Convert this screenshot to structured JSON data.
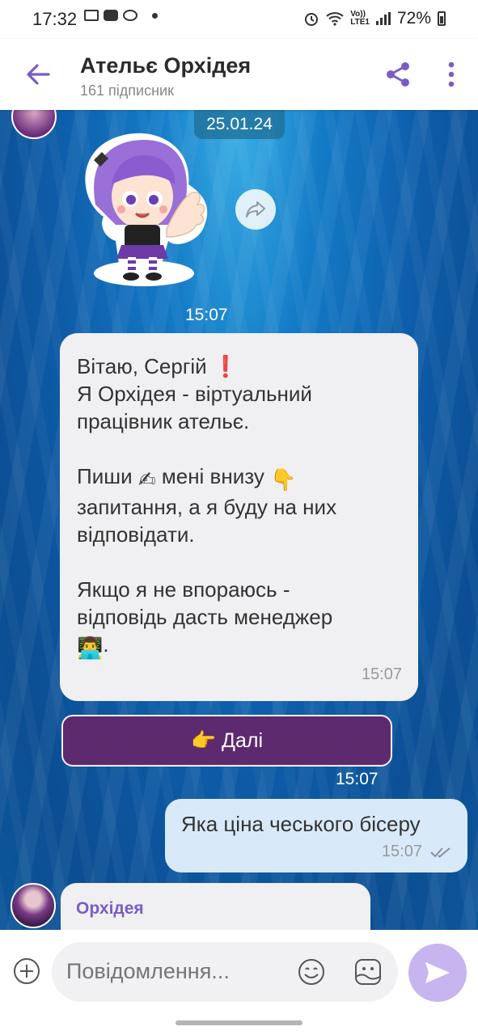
{
  "status_bar": {
    "time": "17:32",
    "network_small_top": "Vo))",
    "network_small_bottom": "LTE1",
    "battery": "72%"
  },
  "header": {
    "title": "Ательє Орхідея",
    "subtitle": "161 підписник",
    "accent_color": "#7b5cc6"
  },
  "chat": {
    "date": "25.01.24",
    "sticker_time": "15:07",
    "message": {
      "line1": "Вітаю, Сергій ❗",
      "line2": "Я Орхідея - віртуальний",
      "line3": "працівник ательє.",
      "line4a": "Пиши",
      "line4b": "мені внизу",
      "line5": "запитання, а я буду на них",
      "line6": "відповідати.",
      "line7": "Якщо я не впораюсь -",
      "line8": "відповідь дасть менеджер",
      "line9": ".",
      "time": "15:07",
      "emoji_write": "✍",
      "emoji_point_down": "👇",
      "emoji_manager": "👨‍💻"
    },
    "next_button": {
      "emoji": "👉",
      "label": "Далі",
      "time": "15:07",
      "color": "#5e2a6f"
    },
    "outgoing": {
      "text": "Яка ціна чеського бісеру",
      "time": "15:07"
    },
    "partial_sender": "Орхідея"
  },
  "input": {
    "placeholder": "Повідомлення..."
  }
}
